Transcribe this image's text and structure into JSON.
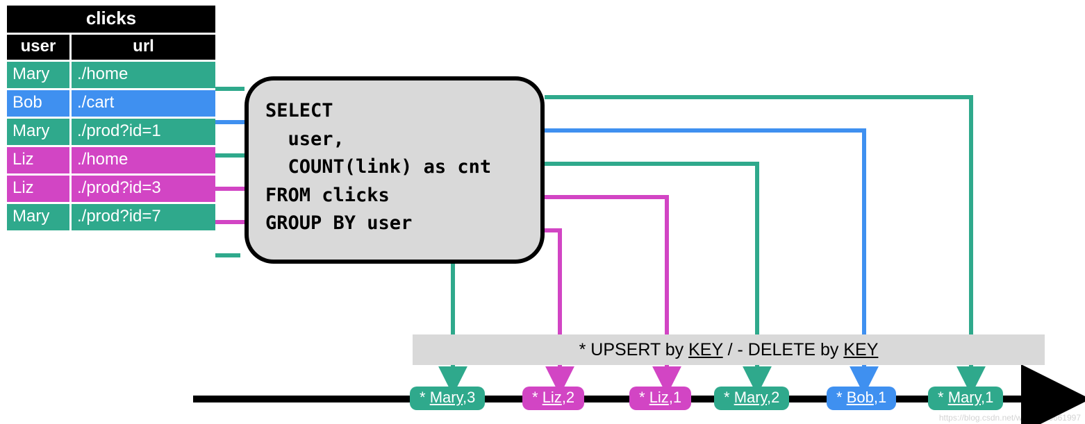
{
  "colors": {
    "teal": "#2fa98c",
    "blue": "#3f90f0",
    "pink": "#d245c4",
    "gray": "#d9d9d9"
  },
  "table": {
    "title": "clicks",
    "headers": {
      "user": "user",
      "url": "url"
    },
    "rows": [
      {
        "user": "Mary",
        "url": "./home",
        "color": "teal"
      },
      {
        "user": "Bob",
        "url": "./cart",
        "color": "blue"
      },
      {
        "user": "Mary",
        "url": "./prod?id=1",
        "color": "teal"
      },
      {
        "user": "Liz",
        "url": "./home",
        "color": "pink"
      },
      {
        "user": "Liz",
        "url": "./prod?id=3",
        "color": "pink"
      },
      {
        "user": "Mary",
        "url": "./prod?id=7",
        "color": "teal"
      }
    ]
  },
  "sql": "SELECT\n  user,\n  COUNT(link) as cnt\nFROM clicks\nGROUP BY user",
  "upsert_bar": {
    "prefix": "* UPSERT by ",
    "key1": "KEY",
    "mid": " / - DELETE by ",
    "key2": "KEY"
  },
  "timeline": [
    {
      "label_prefix": "* ",
      "name": "Mary",
      "rest": ",3",
      "color": "teal"
    },
    {
      "label_prefix": "* ",
      "name": "Liz",
      "rest": ",2",
      "color": "pink"
    },
    {
      "label_prefix": "* ",
      "name": "Liz",
      "rest": ",1",
      "color": "pink"
    },
    {
      "label_prefix": "* ",
      "name": "Mary",
      "rest": ",2",
      "color": "teal"
    },
    {
      "label_prefix": "* ",
      "name": "Bob",
      "rest": ",1",
      "color": "blue"
    },
    {
      "label_prefix": "* ",
      "name": "Mary",
      "rest": ",1",
      "color": "teal"
    }
  ],
  "watermark": "https://blog.csdn.net/weixin_43661997"
}
